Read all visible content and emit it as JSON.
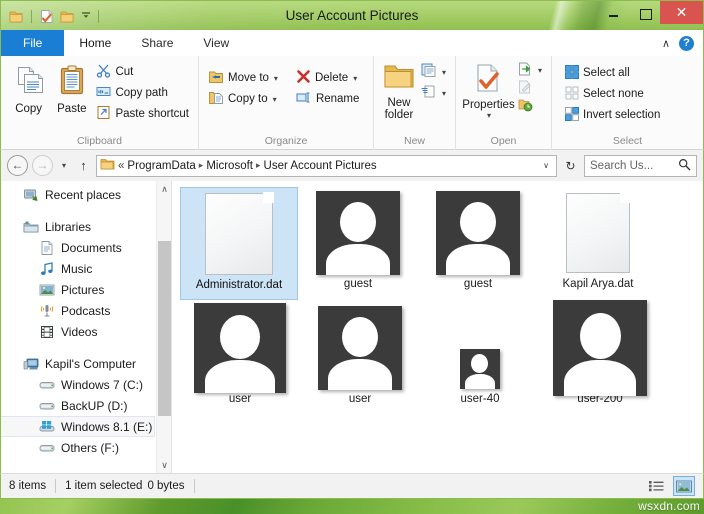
{
  "window": {
    "title": "User Account Pictures",
    "quick_access": [
      {
        "name": "folder-icon",
        "label": "Folder"
      },
      {
        "name": "properties-icon",
        "label": "Properties"
      },
      {
        "name": "new-folder-icon",
        "label": "New folder"
      },
      {
        "name": "chevron-down-icon",
        "label": "Customize Quick Access Toolbar"
      }
    ],
    "controls": {
      "minimize": "–",
      "maximize": "□",
      "close": "✕"
    },
    "accent_green": "#9ac75c",
    "close_red": "#d9534f"
  },
  "tabs": {
    "file": "File",
    "items": [
      {
        "label": "Home",
        "active": true
      },
      {
        "label": "Share",
        "active": false
      },
      {
        "label": "View",
        "active": false
      }
    ],
    "collapse_icon": "∧",
    "help_label": "?"
  },
  "ribbon": {
    "groups": [
      {
        "name": "clipboard",
        "label": "Clipboard",
        "big_buttons": [
          {
            "label": "Copy",
            "icon": "copy-icon"
          },
          {
            "label": "Paste",
            "icon": "paste-icon"
          }
        ],
        "small_buttons": [
          {
            "label": "Cut",
            "icon": "scissors-icon"
          },
          {
            "label": "Copy path",
            "icon": "copy-path-icon"
          },
          {
            "label": "Paste shortcut",
            "icon": "paste-shortcut-icon"
          }
        ]
      },
      {
        "name": "organize",
        "label": "Organize",
        "small_buttons": [
          {
            "label": "Move to",
            "icon": "move-to-icon",
            "caret": true
          },
          {
            "label": "Copy to",
            "icon": "copy-to-icon",
            "caret": true
          },
          {
            "label": "Delete",
            "icon": "delete-icon",
            "caret": true
          },
          {
            "label": "Rename",
            "icon": "rename-icon",
            "caret": false
          }
        ]
      },
      {
        "name": "new",
        "label": "New",
        "big_buttons": [
          {
            "label": "New\nfolder",
            "label_line1": "New",
            "label_line2": "folder",
            "icon": "new-folder-icon"
          }
        ],
        "small_buttons": [
          {
            "label": "",
            "icon": "new-item-icon",
            "caret": true
          },
          {
            "label": "",
            "icon": "easy-access-icon",
            "caret": true
          }
        ]
      },
      {
        "name": "open",
        "label": "Open",
        "big_buttons": [
          {
            "label": "Properties",
            "icon": "properties-icon",
            "caret": true
          }
        ],
        "small_buttons": [
          {
            "label": "",
            "icon": "open-icon",
            "caret": true
          },
          {
            "label": "",
            "icon": "edit-icon",
            "caret": false
          },
          {
            "label": "",
            "icon": "history-icon",
            "caret": false
          }
        ]
      },
      {
        "name": "select",
        "label": "Select",
        "small_buttons": [
          {
            "label": "Select all",
            "icon": "select-all-icon"
          },
          {
            "label": "Select none",
            "icon": "select-none-icon"
          },
          {
            "label": "Invert selection",
            "icon": "invert-selection-icon"
          }
        ]
      }
    ]
  },
  "address_bar": {
    "back_icon": "←",
    "forward_icon": "→",
    "recent_icon": "▾",
    "up_icon": "↑",
    "folder_icon": "folder-icon",
    "overflow": "«",
    "crumbs": [
      "ProgramData",
      "Microsoft",
      "User Account Pictures"
    ],
    "crumb_separator": "▸",
    "dropdown_icon": "∨",
    "refresh_icon": "↻",
    "search_placeholder": "Search Us...",
    "search_value": "",
    "search_icon": "search-icon"
  },
  "sidebar": {
    "items": [
      {
        "label": "Recent places",
        "icon": "recent-places-icon",
        "level": 0,
        "gap_after": true
      },
      {
        "label": "Libraries",
        "icon": "libraries-icon",
        "level": 0
      },
      {
        "label": "Documents",
        "icon": "documents-icon",
        "level": 1
      },
      {
        "label": "Music",
        "icon": "music-icon",
        "level": 1
      },
      {
        "label": "Pictures",
        "icon": "pictures-icon",
        "level": 1
      },
      {
        "label": "Podcasts",
        "icon": "podcasts-icon",
        "level": 1
      },
      {
        "label": "Videos",
        "icon": "videos-icon",
        "level": 1,
        "gap_after": true
      },
      {
        "label": "Kapil's Computer",
        "icon": "computer-icon",
        "level": 0
      },
      {
        "label": "Windows 7 (C:)",
        "icon": "drive-icon",
        "level": 1
      },
      {
        "label": "BackUP (D:)",
        "icon": "drive-icon",
        "level": 1
      },
      {
        "label": "Windows 8.1 (E:)",
        "icon": "windows-drive-icon",
        "level": 1,
        "hover": true
      },
      {
        "label": "Others (F:)",
        "icon": "drive-icon",
        "level": 1
      }
    ],
    "scroll_up_icon": "∧",
    "scroll_down_icon": "∨"
  },
  "files": [
    {
      "name": "Administrator.dat",
      "type": "dat",
      "size": 96,
      "selected": true
    },
    {
      "name": "guest",
      "type": "avatar",
      "size": 84,
      "selected": false
    },
    {
      "name": "guest",
      "type": "avatar",
      "size": 84,
      "selected": false
    },
    {
      "name": "Kapil Arya.dat",
      "type": "dat",
      "size": 84,
      "selected": false
    },
    {
      "name": "user",
      "type": "avatar",
      "size": 90,
      "selected": false
    },
    {
      "name": "user",
      "type": "avatar",
      "size": 84,
      "selected": false
    },
    {
      "name": "user-40",
      "type": "avatar",
      "size": 40,
      "selected": false
    },
    {
      "name": "user-200",
      "type": "avatar",
      "size": 96,
      "selected": false
    }
  ],
  "status_bar": {
    "item_count": "8 items",
    "selection": "1 item selected",
    "selection_size": "0 bytes",
    "views": [
      {
        "name": "details-view-button",
        "active": false
      },
      {
        "name": "large-icons-view-button",
        "active": true
      }
    ]
  },
  "watermark": "wsxdn.com"
}
